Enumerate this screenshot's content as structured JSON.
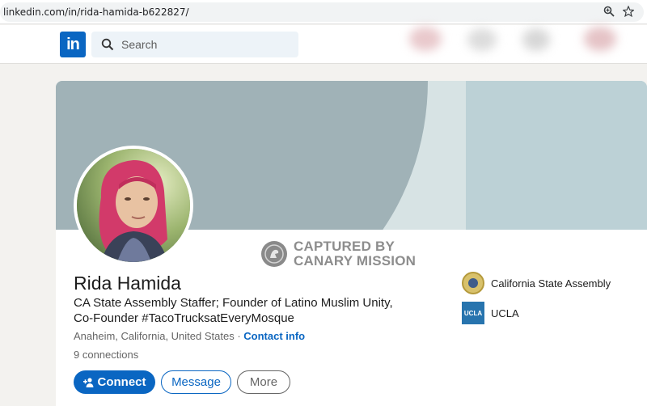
{
  "browser": {
    "url": "linkedin.com/in/rida-hamida-b622827/",
    "icons": [
      "zoom-icon",
      "star-icon"
    ]
  },
  "nav": {
    "logo_text": "in",
    "search_placeholder": "Search"
  },
  "watermark": {
    "line1": "CAPTURED BY",
    "line2": "CANARY MISSION"
  },
  "profile": {
    "name": "Rida Hamida",
    "headline": "CA State Assembly Staffer; Founder of Latino Muslim Unity, Co-Founder #TacoTrucksatEveryMosque",
    "location": "Anaheim, California, United States",
    "separator": " · ",
    "contact_info": "Contact info",
    "connections_count": "9",
    "connections_label": " connections"
  },
  "actions": {
    "connect": "Connect",
    "message": "Message",
    "more": "More"
  },
  "orgs": [
    {
      "label": "California State Assembly",
      "icon": "assembly-seal-icon"
    },
    {
      "label": "UCLA",
      "icon": "ucla-logo-icon",
      "logo_text": "UCLA"
    }
  ],
  "colors": {
    "brand": "#0a66c2",
    "page_bg": "#f3f2ef"
  }
}
